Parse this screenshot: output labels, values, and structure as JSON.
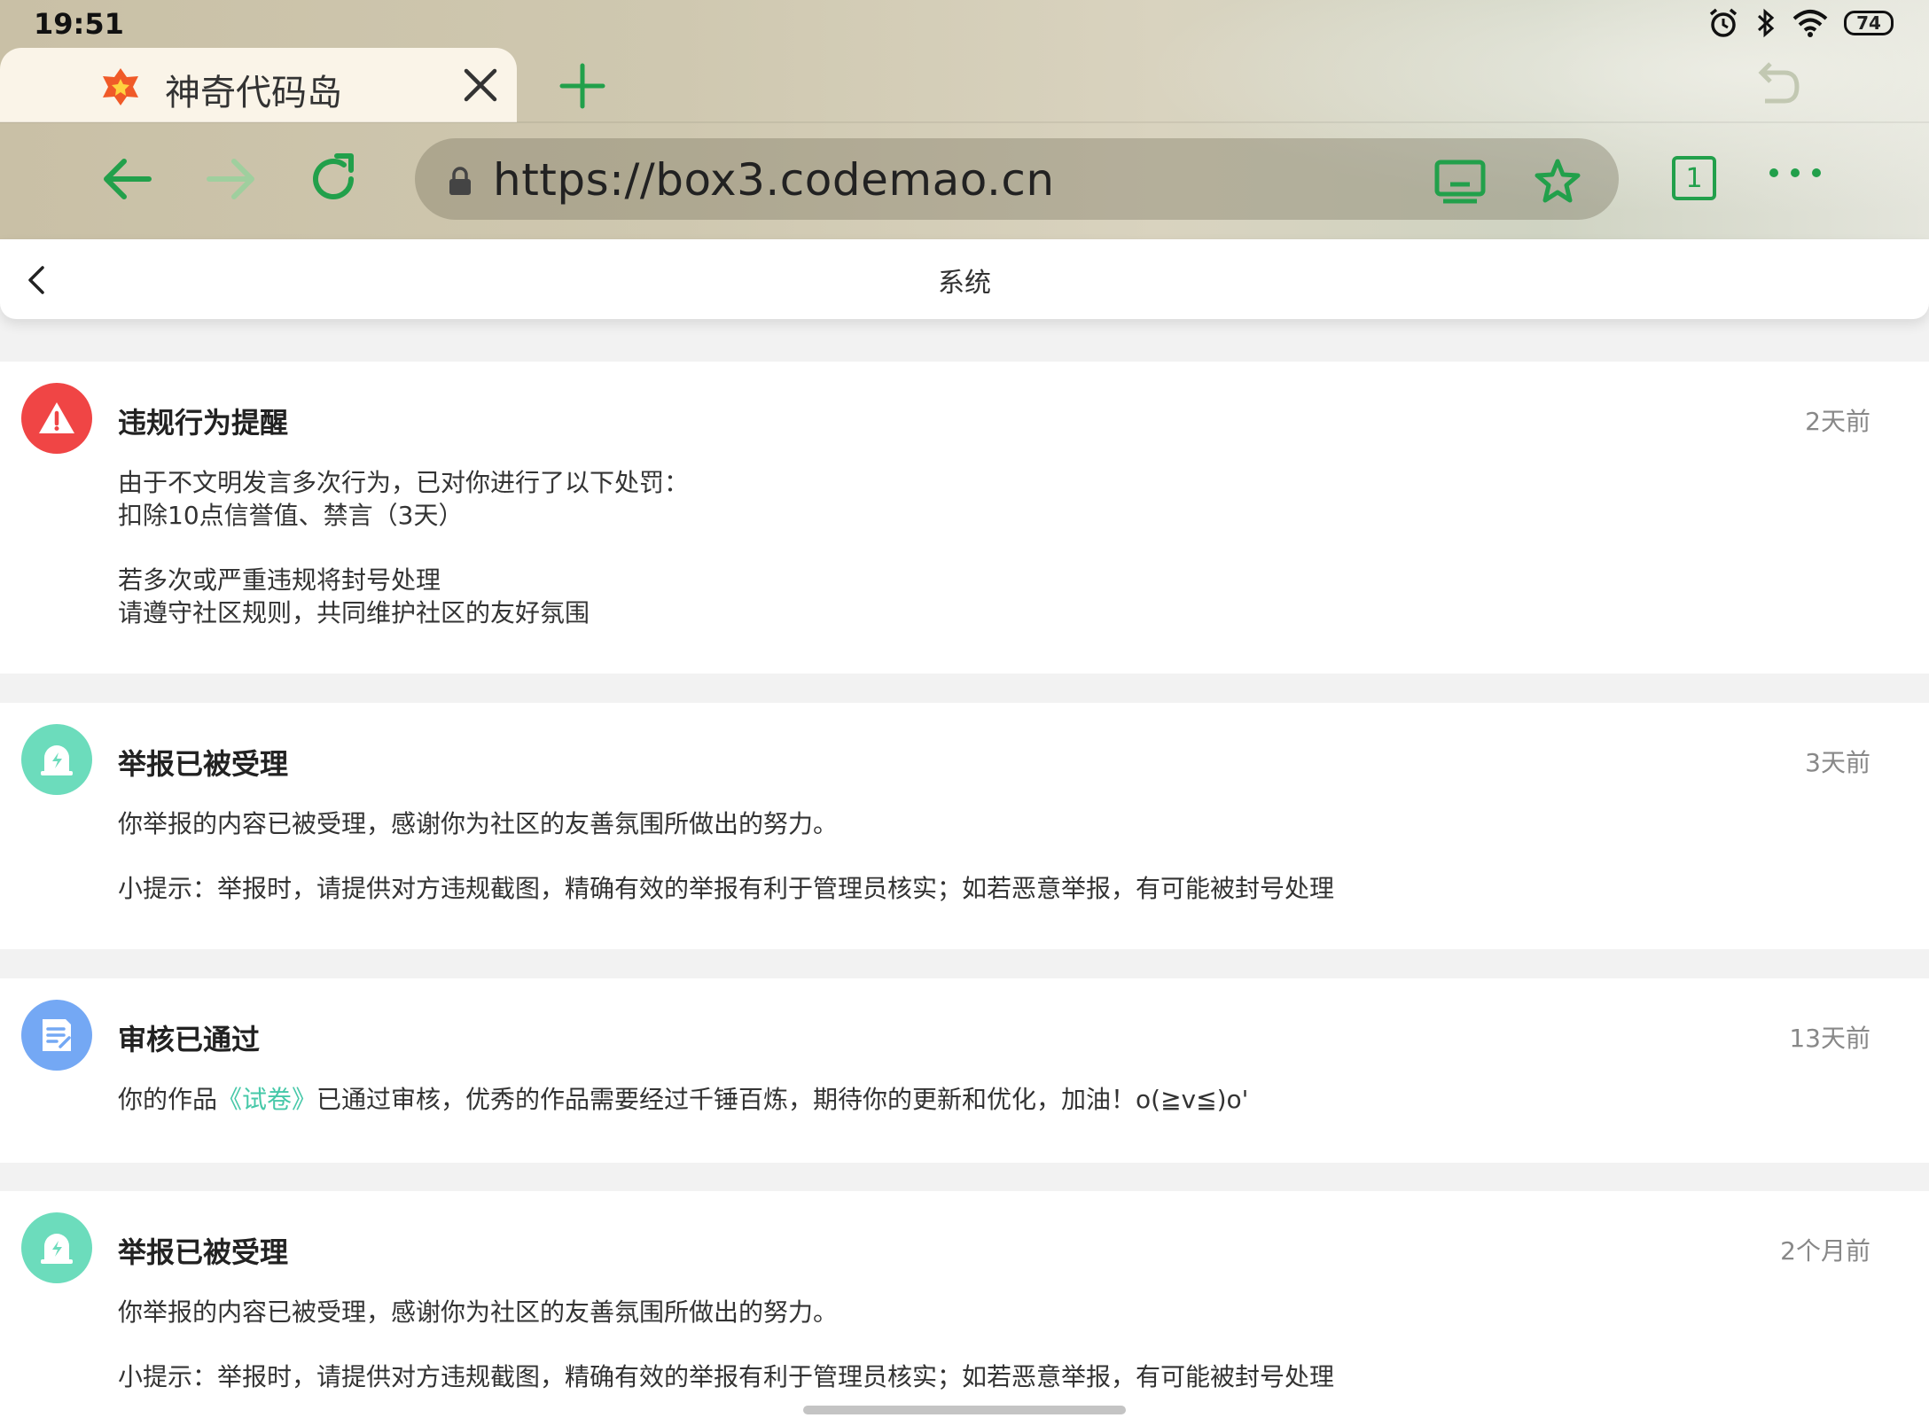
{
  "status_bar": {
    "time": "19:51",
    "battery": "74",
    "icons": [
      "alarm-icon",
      "bluetooth-icon",
      "wifi-icon",
      "battery-icon"
    ]
  },
  "browser": {
    "tab_title": "神奇代码岛",
    "url": "https://box3.codemao.cn",
    "tabs_count": "1",
    "accent_color": "#22a04b"
  },
  "page": {
    "title": "系统"
  },
  "messages": [
    {
      "title": "违规行为提醒",
      "time": "2天前",
      "icon": "warning-icon",
      "icon_color": "#f04545",
      "lines": [
        "由于不文明发言多次行为，已对你进行了以下处罚：",
        "扣除10点信誉值、禁言（3天）",
        "若多次或严重违规将封号处理",
        "请遵守社区规则，共同维护社区的友好氛围"
      ]
    },
    {
      "title": "举报已被受理",
      "time": "3天前",
      "icon": "report-accepted-icon",
      "icon_color": "#6cdcbc",
      "lines": [
        "你举报的内容已被受理，感谢你为社区的友善氛围所做出的努力。",
        "小提示：举报时，请提供对方违规截图，精确有效的举报有利于管理员核实；如若恶意举报，有可能被封号处理"
      ]
    },
    {
      "title": "审核已通过",
      "time": "13天前",
      "icon": "document-approved-icon",
      "icon_color": "#74a8f4",
      "line_before": "你的作品",
      "work_name": "《试卷》",
      "line_after": "已通过审核，优秀的作品需要经过千锤百炼，期待你的更新和优化，加油！o(≧v≦)o'"
    },
    {
      "title": "举报已被受理",
      "time": "2个月前",
      "icon": "report-accepted-icon",
      "icon_color": "#6cdcbc",
      "lines": [
        "你举报的内容已被受理，感谢你为社区的友善氛围所做出的努力。",
        "小提示：举报时，请提供对方违规截图，精确有效的举报有利于管理员核实；如若恶意举报，有可能被封号处理"
      ]
    }
  ]
}
